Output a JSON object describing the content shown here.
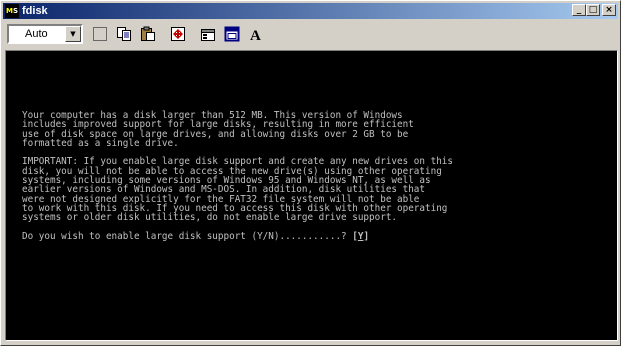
{
  "window": {
    "title": "fdisk",
    "buttons": {
      "minimize": "_",
      "maximize": "□",
      "close": "×"
    }
  },
  "toolbar": {
    "font_size": "Auto",
    "tools": [
      "mark-icon",
      "copy-icon",
      "paste-icon",
      "fullscreen-icon",
      "properties-icon",
      "background-icon",
      "font-icon"
    ]
  },
  "console": {
    "para1": [
      "Your computer has a disk larger than 512 MB. This version of Windows",
      "includes improved support for large disks, resulting in more efficient",
      "use of disk space on large drives, and allowing disks over 2 GB to be",
      "formatted as a single drive."
    ],
    "para2": [
      "IMPORTANT: If you enable large disk support and create any new drives on this",
      "disk, you will not be able to access the new drive(s) using other operating",
      "systems, including some versions of Windows 95 and Windows NT, as well as",
      "earlier versions of Windows and MS-DOS. In addition, disk utilities that",
      "were not designed explicitly for the FAT32 file system will not be able",
      "to work with this disk. If you need to access this disk with other operating",
      "systems or older disk utilities, do not enable large drive support."
    ],
    "prompt": "Do you wish to enable large disk support (Y/N)...........? ",
    "answer_open": "[",
    "answer_value": "Y",
    "answer_close": "]"
  }
}
